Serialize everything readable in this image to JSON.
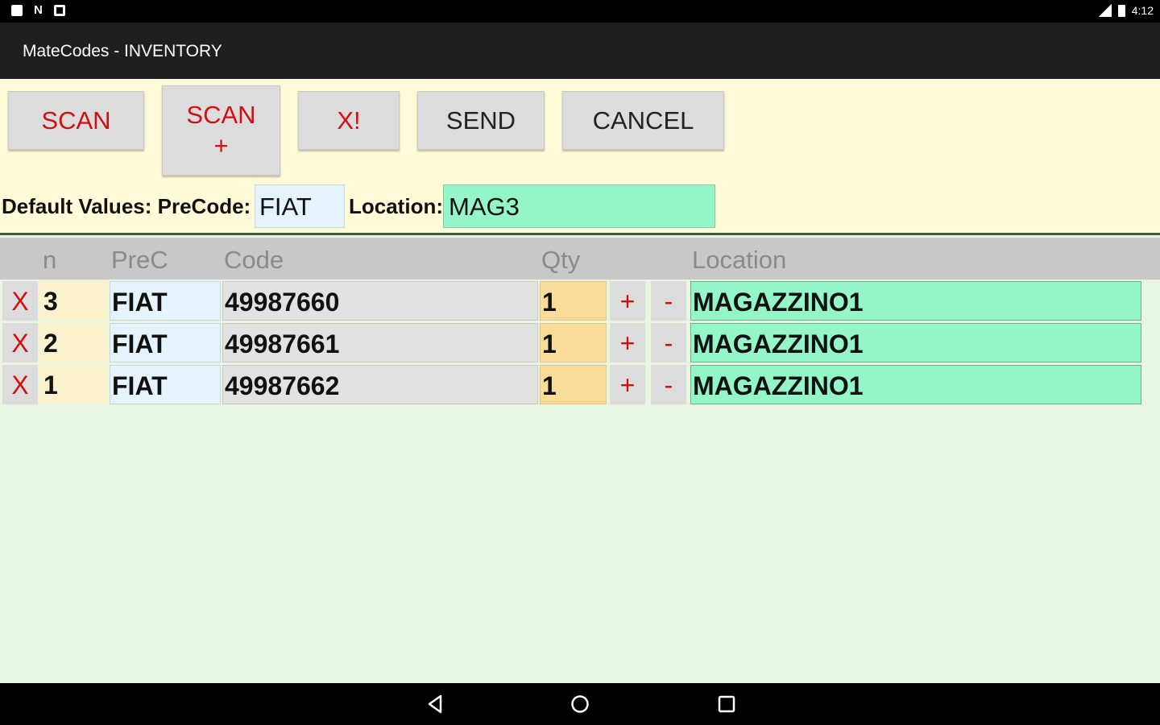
{
  "status_bar": {
    "time": "4:12",
    "left_icons": [
      "notification-icon",
      "n-icon",
      "screenshot-icon"
    ],
    "right_icons": [
      "signal-icon",
      "battery-icon"
    ]
  },
  "app": {
    "title": "MateCodes - INVENTORY"
  },
  "toolbar": {
    "scan_label": "SCAN",
    "scan_plus_label": "SCAN",
    "scan_plus_sub": "+",
    "clear_label": "X!",
    "send_label": "SEND",
    "cancel_label": "CANCEL"
  },
  "defaults": {
    "label": "Default Values: PreCode:",
    "precode_value": "FIAT",
    "location_label": "Location:",
    "location_value": "MAG3"
  },
  "table": {
    "headers": {
      "n": "n",
      "prec": "PreC",
      "code": "Code",
      "qty": "Qty",
      "location": "Location"
    },
    "rows": [
      {
        "delete": "X",
        "n": "3",
        "prec": "FIAT",
        "code": "49987660",
        "qty": "1",
        "plus": "+",
        "minus": "-",
        "location": "MAGAZZINO1"
      },
      {
        "delete": "X",
        "n": "2",
        "prec": "FIAT",
        "code": "49987661",
        "qty": "1",
        "plus": "+",
        "minus": "-",
        "location": "MAGAZZINO1"
      },
      {
        "delete": "X",
        "n": "1",
        "prec": "FIAT",
        "code": "49987662",
        "qty": "1",
        "plus": "+",
        "minus": "-",
        "location": "MAGAZZINO1"
      }
    ]
  },
  "nav_bar": {
    "icons": [
      "back-icon",
      "home-icon",
      "recents-icon"
    ]
  },
  "colors": {
    "title_bar": "#1f1f1f",
    "panel_bg": "#fffbd8",
    "body_bg": "#e8f5e0",
    "button_red_text": "#d01010",
    "location_green": "#94f5c8",
    "qty_orange": "#f9dc98",
    "precode_blue": "#e5f4fc"
  }
}
